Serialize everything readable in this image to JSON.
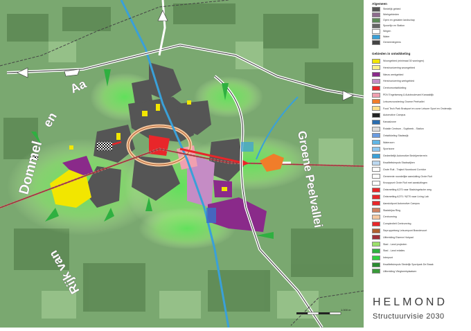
{
  "title": "HELMOND",
  "subtitle": "Structuurvisie",
  "year": "2030",
  "map_labels": {
    "aa": "Aa",
    "en": "en",
    "dommel": "Dommel",
    "rijk_van": "Rijk van",
    "groene_peelvallei": "Groene Peelvallei"
  },
  "scale_label": "1.000 m",
  "legend": {
    "section1": "Algemeen",
    "items1": [
      {
        "label": "Stedelijk gebied",
        "color": "#555555"
      },
      {
        "label": "Werkgebieden",
        "color": "#8e6b8e"
      },
      {
        "label": "Open en geslaten landschap",
        "color": "#5c8a57"
      },
      {
        "label": "Spoorlijn en Station",
        "color": "#666666"
      },
      {
        "label": "Wegen",
        "color": "#ffffff"
      },
      {
        "label": "Water",
        "color": "#3aa0d8"
      },
      {
        "label": "Gemeentegrens",
        "color": "#444444"
      }
    ],
    "section2": "Gebieden in ontwikkeling",
    "items2": [
      {
        "label": "Woongebied (minimaal 30 woningen)",
        "color": "#f2e600"
      },
      {
        "label": "Herstructurering woongebied",
        "color": "#f7f08c"
      },
      {
        "label": "Nieuw werkgebied",
        "color": "#8a2a8a"
      },
      {
        "label": "Herstructurering werkgebied",
        "color": "#c58cc5"
      },
      {
        "label": "Centrumontwikkeling",
        "color": "#e8262a"
      },
      {
        "label": "PDV Engelseweg & Autoboulevard Kanaaldijk",
        "color": "#f0a0b0"
      },
      {
        "label": "Leisurevoorziening Groene Peelvallei",
        "color": "#f07d2a"
      },
      {
        "label": "Food Tech Park Brainport en zone Leisure Sport en Onderwijs",
        "color": "#ffe08a"
      },
      {
        "label": "Automotive Campus",
        "color": "#222222"
      },
      {
        "label": "Kanaalzone",
        "color": "#2a6db0"
      },
      {
        "label": "Rotatie Centrum - Suytbeek - Station",
        "color": "#dddddd"
      },
      {
        "label": "Ontwikkeling Stadswijk",
        "color": "#6a9be0"
      },
      {
        "label": "Waterzorn",
        "color": "#5fb6e6"
      },
      {
        "label": "Sportzone",
        "color": "#8ec8f0"
      },
      {
        "label": "Gedeeltelijk Automotive Bedrijventerrein",
        "color": "#3aa0d8"
      },
      {
        "label": "Kwaliteitsimpuls Stadswijken",
        "color": "#bcd8f0"
      },
      {
        "label": "Grote Ruit - Traject Noordoost Corridor",
        "color": "#ffffff"
      },
      {
        "label": "Gemeente noordelijke aansluiting Grote Ruit",
        "color": "#ffffff"
      },
      {
        "label": "Knooppunt Grote Ruit met aansluitingen",
        "color": "#ffffff"
      },
      {
        "label": "Ontsmetting A270 naar Stadsingelsche weg",
        "color": "#e8262a"
      },
      {
        "label": "Ontsmetting A270 / N270 naar Living Lab",
        "color": "#e8262a"
      },
      {
        "label": "Aansluitpunt Automotive Campus",
        "color": "#e8262a"
      },
      {
        "label": "Stadsbijna Ring",
        "color": "#d08060"
      },
      {
        "label": "Centrumring",
        "color": "#f5c8a0"
      },
      {
        "label": "Complexiteit Centrumring",
        "color": "#e8262a"
      },
      {
        "label": "Sepruppelweg Leisurepunt Brandevoort",
        "color": "#b06030"
      },
      {
        "label": "Uitbreiding Eiserne Hokpad",
        "color": "#a0303a"
      },
      {
        "label": "Stad - Land projecten",
        "color": "#9be06a"
      },
      {
        "label": "Stad - Land relaties",
        "color": "#2fb040"
      },
      {
        "label": "Interpunt",
        "color": "#2fd040"
      },
      {
        "label": "Kwaliteitsimpuls Stedelijk Sportpark De Braak",
        "color": "#2a8a30"
      },
      {
        "label": "Uitbreiding Vliegtwerkplaatsen",
        "color": "#3a9a3a"
      }
    ]
  }
}
